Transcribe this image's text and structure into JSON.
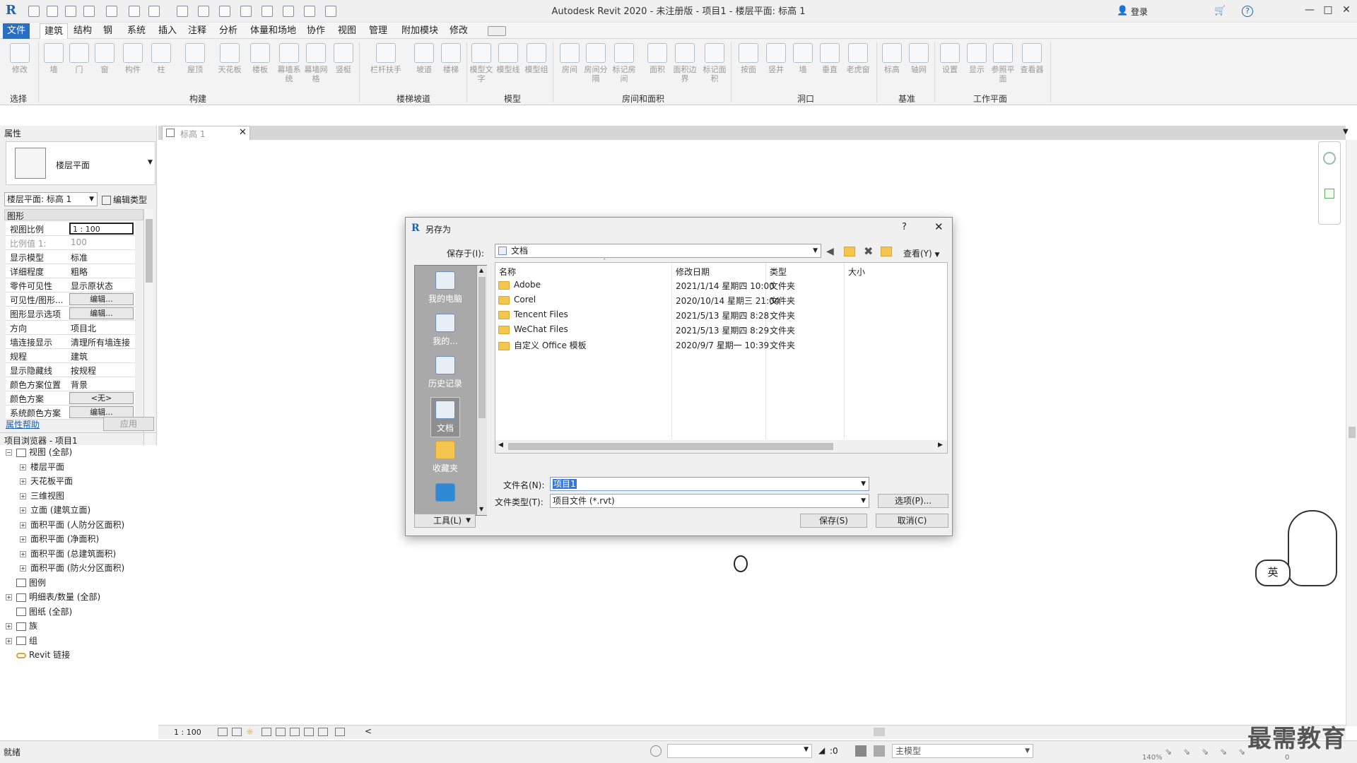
{
  "window": {
    "title": "Autodesk Revit 2020 - 未注册版 - 项目1 - 楼层平面: 标高 1",
    "login": "登录"
  },
  "menu": [
    "文件",
    "建筑",
    "结构",
    "钢",
    "系统",
    "插入",
    "注释",
    "分析",
    "体量和场地",
    "协作",
    "视图",
    "管理",
    "附加模块",
    "修改"
  ],
  "ribbon": {
    "buttons": [
      "修改",
      "墙",
      "门",
      "窗",
      "构件",
      "柱",
      "屋顶",
      "天花板",
      "楼板",
      "幕墙系统",
      "幕墙网格",
      "竖梃",
      "栏杆扶手",
      "坡道",
      "楼梯",
      "模型文字",
      "模型线",
      "模型组",
      "房间",
      "房间分隔",
      "标记房间",
      "面积",
      "面积边界",
      "标记面积",
      "按面",
      "竖井",
      "墙",
      "垂直",
      "老虎窗",
      "标高",
      "轴网",
      "设置",
      "显示",
      "参照平面",
      "查看器"
    ],
    "groups": [
      "选择",
      "构建",
      "楼梯坡道",
      "模型",
      "房间和面积",
      "洞口",
      "基准",
      "工作平面"
    ]
  },
  "properties": {
    "header": "属性",
    "type_name": "楼层平面",
    "instance": "楼层平面: 标高 1",
    "edit_type": "编辑类型",
    "section": "图形",
    "rows": [
      {
        "k": "视图比例",
        "v": "1 : 100"
      },
      {
        "k": "比例值 1:",
        "v": "100"
      },
      {
        "k": "显示模型",
        "v": "标准"
      },
      {
        "k": "详细程度",
        "v": "粗略"
      },
      {
        "k": "零件可见性",
        "v": "显示原状态"
      },
      {
        "k": "可见性/图形...",
        "v": "编辑..."
      },
      {
        "k": "图形显示选项",
        "v": "编辑..."
      },
      {
        "k": "方向",
        "v": "项目北"
      },
      {
        "k": "墙连接显示",
        "v": "清理所有墙连接"
      },
      {
        "k": "规程",
        "v": "建筑"
      },
      {
        "k": "显示隐藏线",
        "v": "按规程"
      },
      {
        "k": "颜色方案位置",
        "v": "背景"
      },
      {
        "k": "颜色方案",
        "v": "<无>"
      },
      {
        "k": "系统颜色方案",
        "v": "编辑..."
      }
    ],
    "help": "属性帮助",
    "apply": "应用"
  },
  "browser": {
    "header": "项目浏览器 - 项目1",
    "items": [
      "视图 (全部)",
      "楼层平面",
      "天花板平面",
      "三维视图",
      "立面 (建筑立面)",
      "面积平面 (人防分区面积)",
      "面积平面 (净面积)",
      "面积平面 (总建筑面积)",
      "面积平面 (防火分区面积)",
      "图例",
      "明细表/数量 (全部)",
      "图纸 (全部)",
      "族",
      "组",
      "Revit 链接"
    ]
  },
  "doc_tab": "标高 1",
  "dialog": {
    "title": "另存为",
    "help": "?",
    "save_in_label": "保存于(I):",
    "save_in_value": "文档",
    "view_menu": "查看(Y)",
    "places": [
      "我的电脑",
      "我的...",
      "历史记录",
      "文档",
      "收藏夹"
    ],
    "columns": [
      "名称",
      "修改日期",
      "类型",
      "大小"
    ],
    "files": [
      {
        "name": "Adobe",
        "date": "2021/1/14 星期四 10:00",
        "type": "文件夹"
      },
      {
        "name": "Corel",
        "date": "2020/10/14 星期三 21:04",
        "type": "文件夹"
      },
      {
        "name": "Tencent Files",
        "date": "2021/5/13 星期四 8:28",
        "type": "文件夹"
      },
      {
        "name": "WeChat Files",
        "date": "2021/5/13 星期四 8:29",
        "type": "文件夹"
      },
      {
        "name": "自定义 Office 模板",
        "date": "2020/9/7 星期一 10:39",
        "type": "文件夹"
      }
    ],
    "filename_label": "文件名(N):",
    "filename_value": "项目1",
    "filetype_label": "文件类型(T):",
    "filetype_value": "项目文件 (*.rvt)",
    "options": "选项(P)...",
    "tools": "工具(L)",
    "save": "保存(S)",
    "cancel": "取消(C)"
  },
  "viewbar": {
    "scale": "1 : 100"
  },
  "status": {
    "text": "就绪",
    "selection": ":0",
    "model": "主模型",
    "zoom": "140%",
    "pages": "0"
  },
  "ime": "英",
  "watermark": "最需教育"
}
